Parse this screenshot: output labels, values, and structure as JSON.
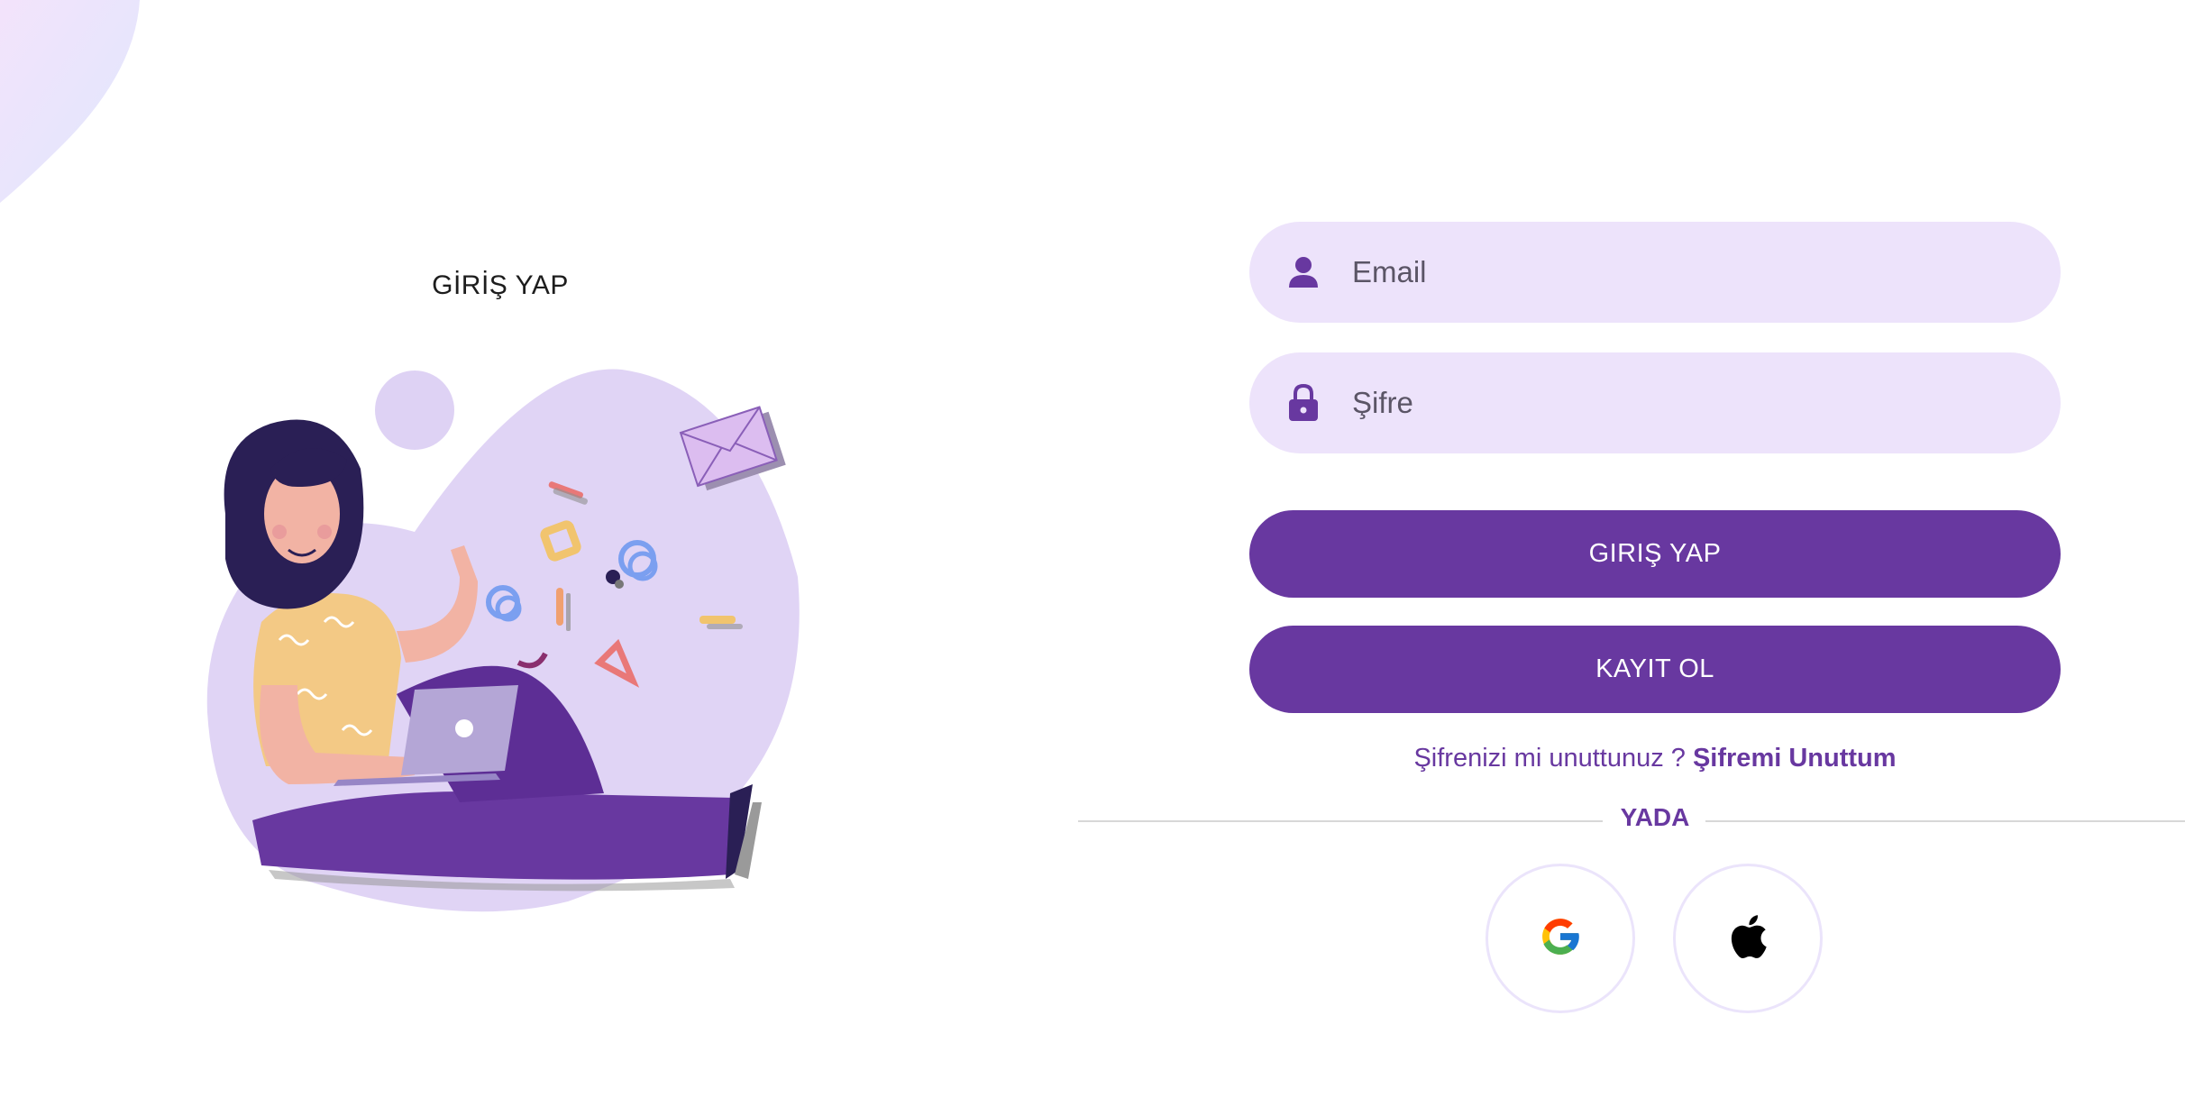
{
  "page": {
    "title": "GİRİŞ YAP"
  },
  "login_form": {
    "email": {
      "placeholder": "Email",
      "value": "",
      "icon": "person-icon"
    },
    "password": {
      "placeholder": "Şifre",
      "value": "",
      "icon": "lock-icon"
    },
    "login_button_label": "GIRIŞ YAP",
    "register_button_label": "KAYIT OL",
    "forgot_prompt": "Şifrenizi mi unuttunuz ?",
    "forgot_link": "Şifremi Unuttum",
    "divider_text": "YADA"
  },
  "social_login": {
    "providers": [
      {
        "name": "google",
        "icon": "google-icon"
      },
      {
        "name": "apple",
        "icon": "apple-icon"
      }
    ]
  },
  "theme": {
    "primary": "#6838a0",
    "field_background": "#ede3fb",
    "illustration_blob": "#e0d4f5"
  }
}
